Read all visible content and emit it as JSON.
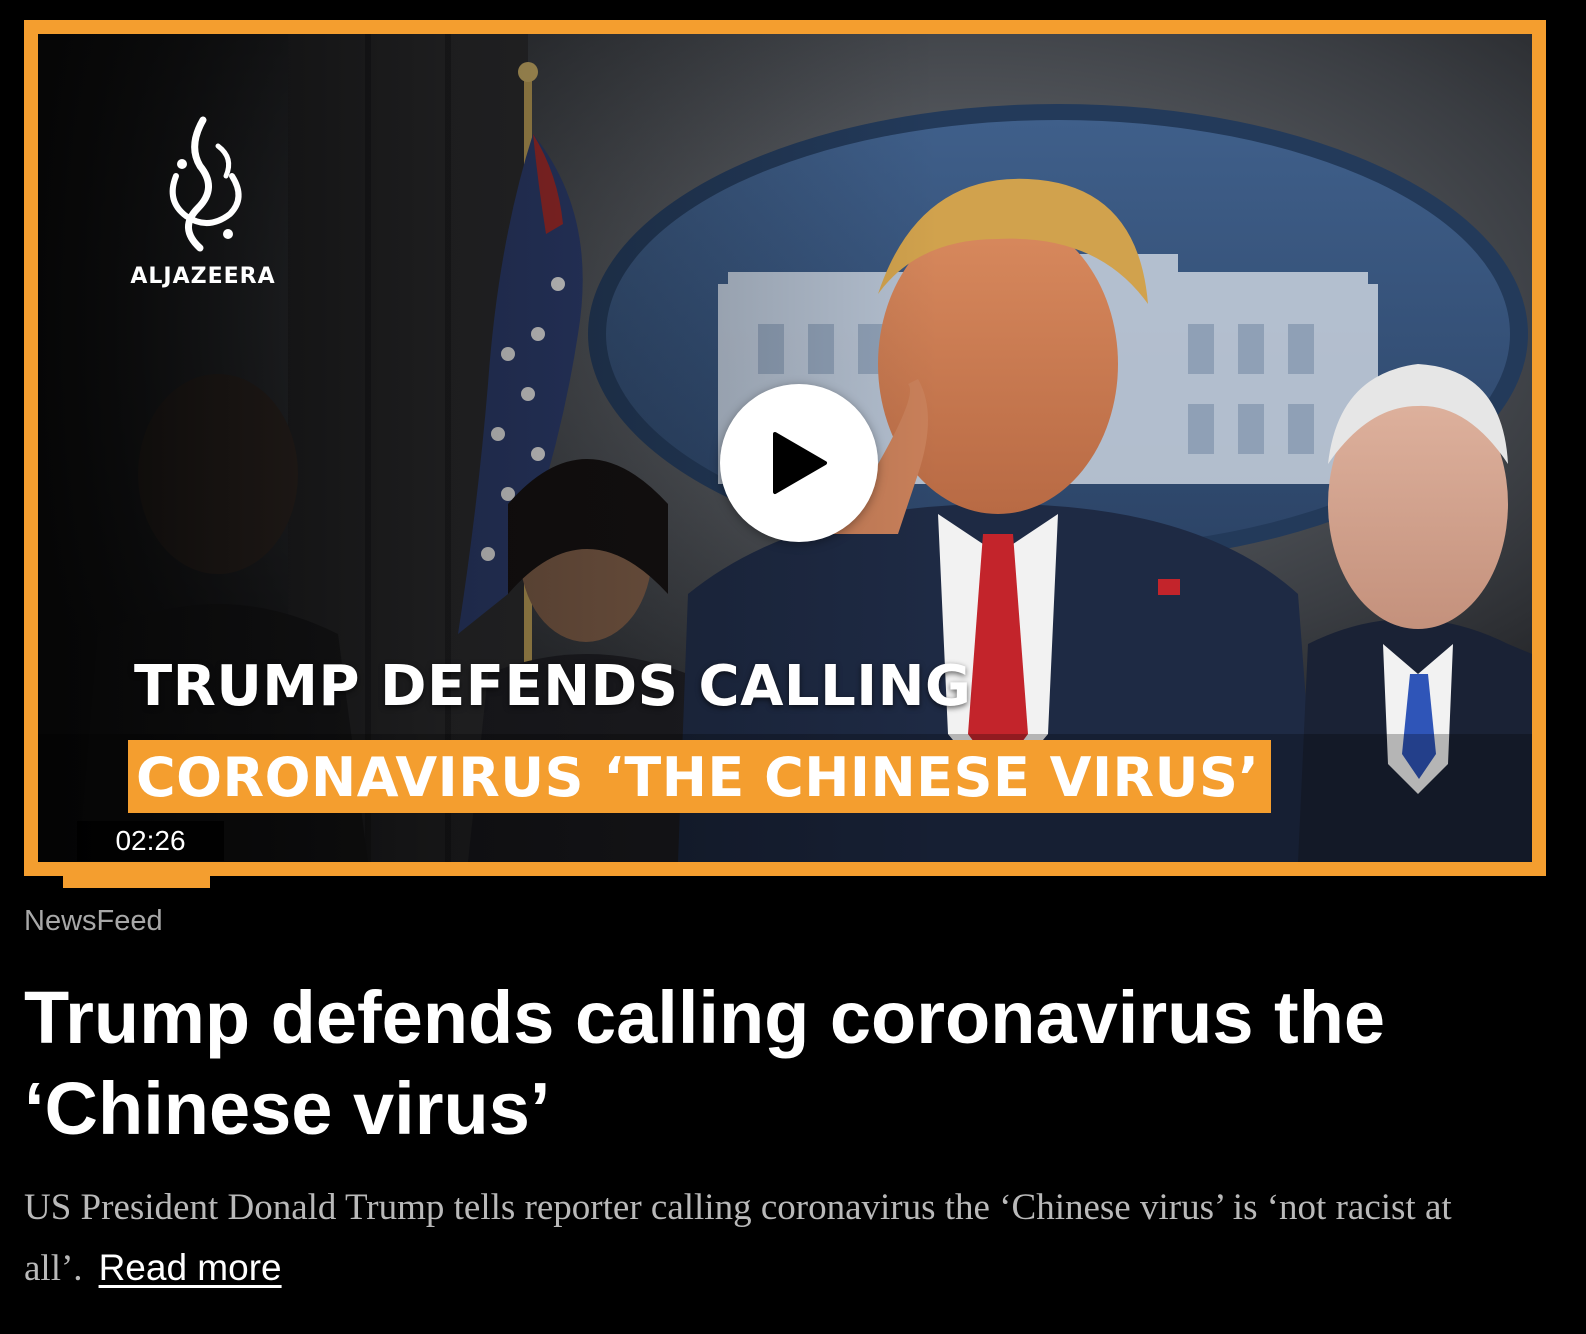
{
  "video": {
    "brand": "ALJAZEERA",
    "overlay_line1": "TRUMP DEFENDS CALLING",
    "overlay_line2": "CORONAVIRUS ‘THE CHINESE VIRUS’",
    "duration": "02:26",
    "accent_color": "#f49e2f"
  },
  "article": {
    "category": "NewsFeed",
    "title": "Trump defends calling coronavirus the ‘Chinese virus’",
    "summary": "US President Donald Trump tells reporter calling coronavirus the ‘Chinese virus’ is ‘not racist at all’.",
    "read_more": "Read more"
  },
  "icons": {
    "play": "play-icon",
    "logo": "aljazeera-logo-icon"
  }
}
